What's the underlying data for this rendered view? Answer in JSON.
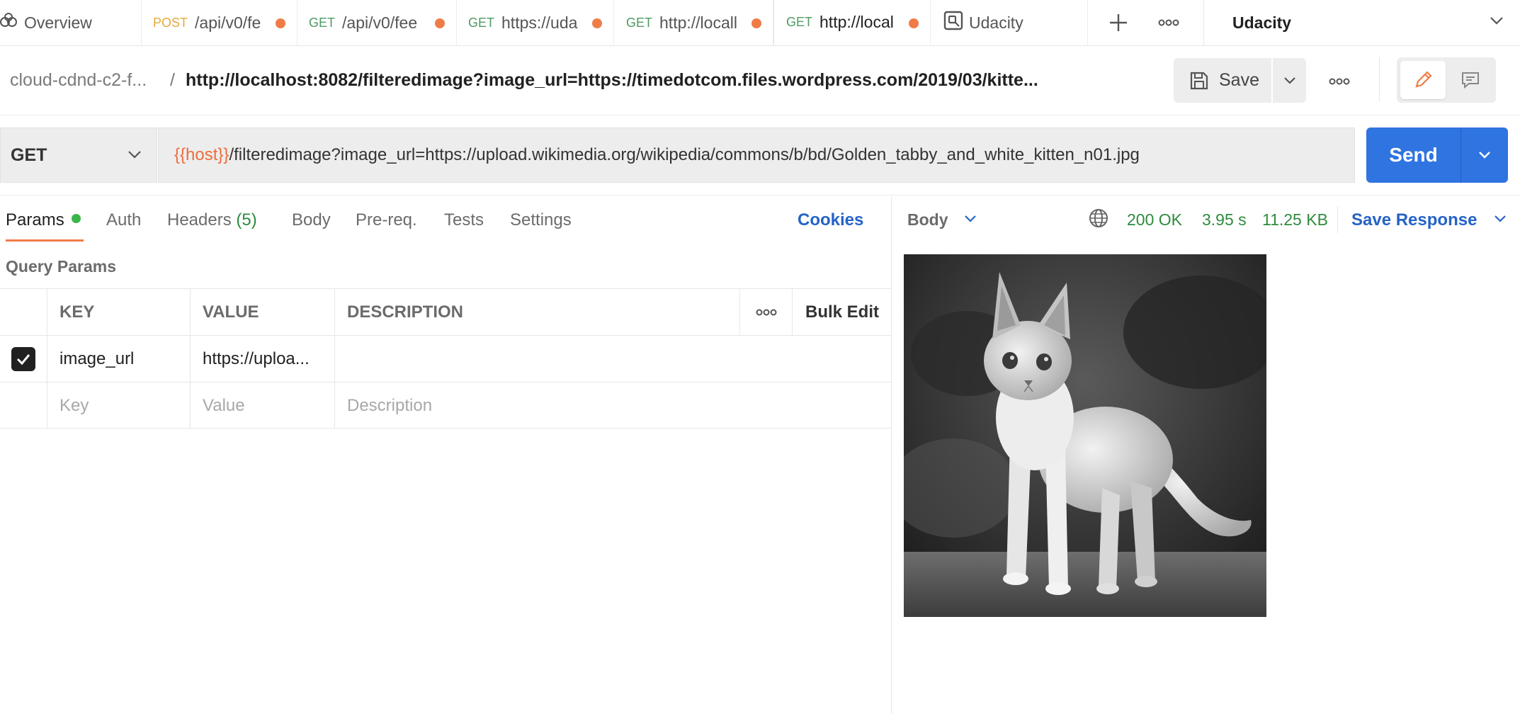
{
  "tabs": {
    "overview_label": "Overview",
    "items": [
      {
        "method": "POST",
        "title": "/api/v0/fe"
      },
      {
        "method": "GET",
        "title": "/api/v0/fee"
      },
      {
        "method": "GET",
        "title": "https://uda"
      },
      {
        "method": "GET",
        "title": "http://locall"
      },
      {
        "method": "GET",
        "title": "http://local"
      }
    ],
    "udacity_tab_label": "Udacity",
    "workspace": "Udacity"
  },
  "breadcrumb": {
    "collection": "cloud-cdnd-c2-f...",
    "separator": "/",
    "request_name": "http://localhost:8082/filteredimage?image_url=https://timedotcom.files.wordpress.com/2019/03/kitte..."
  },
  "toolbar": {
    "save_label": "Save"
  },
  "request": {
    "method": "GET",
    "url_variable": "{{host}}",
    "url_path": "/filteredimage?image_url=https://upload.wikimedia.org/wikipedia/commons/b/bd/Golden_tabby_and_white_kitten_n01.jpg",
    "send_label": "Send"
  },
  "request_tabs": {
    "params": "Params",
    "auth": "Auth",
    "headers": "Headers",
    "headers_count": "(5)",
    "body": "Body",
    "prereq": "Pre-req.",
    "tests": "Tests",
    "settings": "Settings",
    "cookies": "Cookies"
  },
  "query_params": {
    "title": "Query Params",
    "columns": {
      "key": "KEY",
      "value": "VALUE",
      "description": "DESCRIPTION",
      "bulk_edit": "Bulk Edit"
    },
    "rows": [
      {
        "checked": true,
        "key": "image_url",
        "value": "https://uploa...",
        "description": ""
      }
    ],
    "placeholders": {
      "key": "Key",
      "value": "Value",
      "description": "Description"
    }
  },
  "response": {
    "view_label": "Body",
    "status": "200 OK",
    "time": "3.95 s",
    "size": "11.25 KB",
    "save_response_label": "Save Response"
  },
  "colors": {
    "accent_orange": "#ef7c47",
    "primary_blue": "#2f74e0",
    "link_blue": "#2563c7",
    "status_green": "#2e8b3e",
    "post_yellow": "#e5a93c",
    "get_green": "#4f9a63"
  }
}
